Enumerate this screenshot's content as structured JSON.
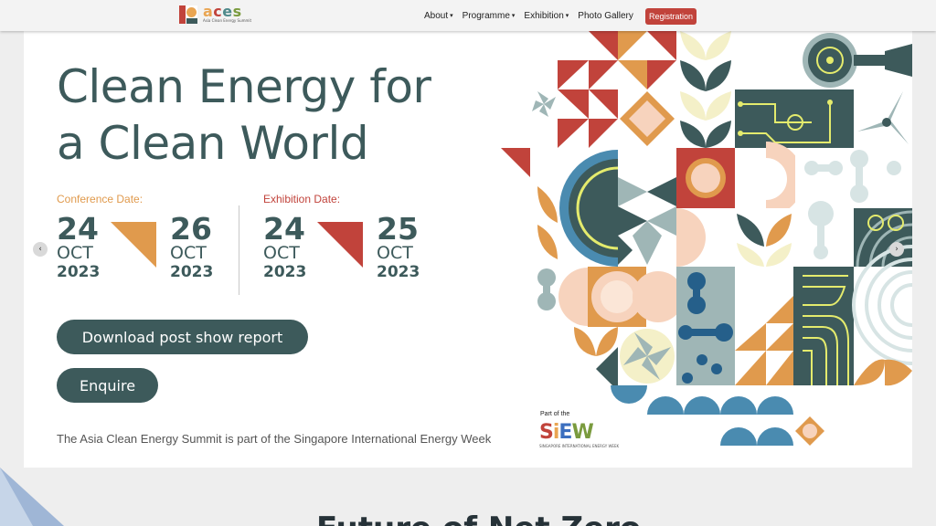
{
  "nav": {
    "logo_word": [
      "a",
      "c",
      "e",
      "s"
    ],
    "logo_sub": "Asia Clean Energy Summit",
    "items": [
      {
        "label": "About",
        "caret": "▾"
      },
      {
        "label": "Programme",
        "caret": "▾"
      },
      {
        "label": "Exhibition",
        "caret": "▾"
      },
      {
        "label": "Photo Gallery",
        "caret": ""
      }
    ],
    "register_label": "Registration"
  },
  "hero": {
    "headline_line1": "Clean Energy for",
    "headline_line2": "a Clean World",
    "conference": {
      "label": "Conference Date:",
      "start": {
        "day": "24",
        "month": "OCT",
        "year": "2023"
      },
      "end": {
        "day": "26",
        "month": "OCT",
        "year": "2023"
      }
    },
    "exhibition": {
      "label": "Exhibition Date:",
      "start": {
        "day": "24",
        "month": "OCT",
        "year": "2023"
      },
      "end": {
        "day": "25",
        "month": "OCT",
        "year": "2023"
      }
    },
    "download_label": "Download post show report",
    "enquire_label": "Enquire",
    "footnote": "The Asia Clean Energy Summit is part of the Singapore International Energy Week",
    "part_of": "Part of the",
    "siew_word": [
      "S",
      "i",
      "E",
      "W"
    ],
    "siew_sub": "SINGAPORE INTERNATIONAL ENERGY WEEK"
  },
  "carousel": {
    "prev": "‹",
    "next": "›"
  },
  "section": {
    "title": "Future of Net Zero"
  },
  "colors": {
    "teal": "#3d5a5b",
    "orange": "#e9a552",
    "red": "#c1433b",
    "peach": "#f7d3bd",
    "cream": "#f4f0c8",
    "lime": "#e4eb6d",
    "blue": "#4a8bb0",
    "sage": "#9fb6b6"
  }
}
